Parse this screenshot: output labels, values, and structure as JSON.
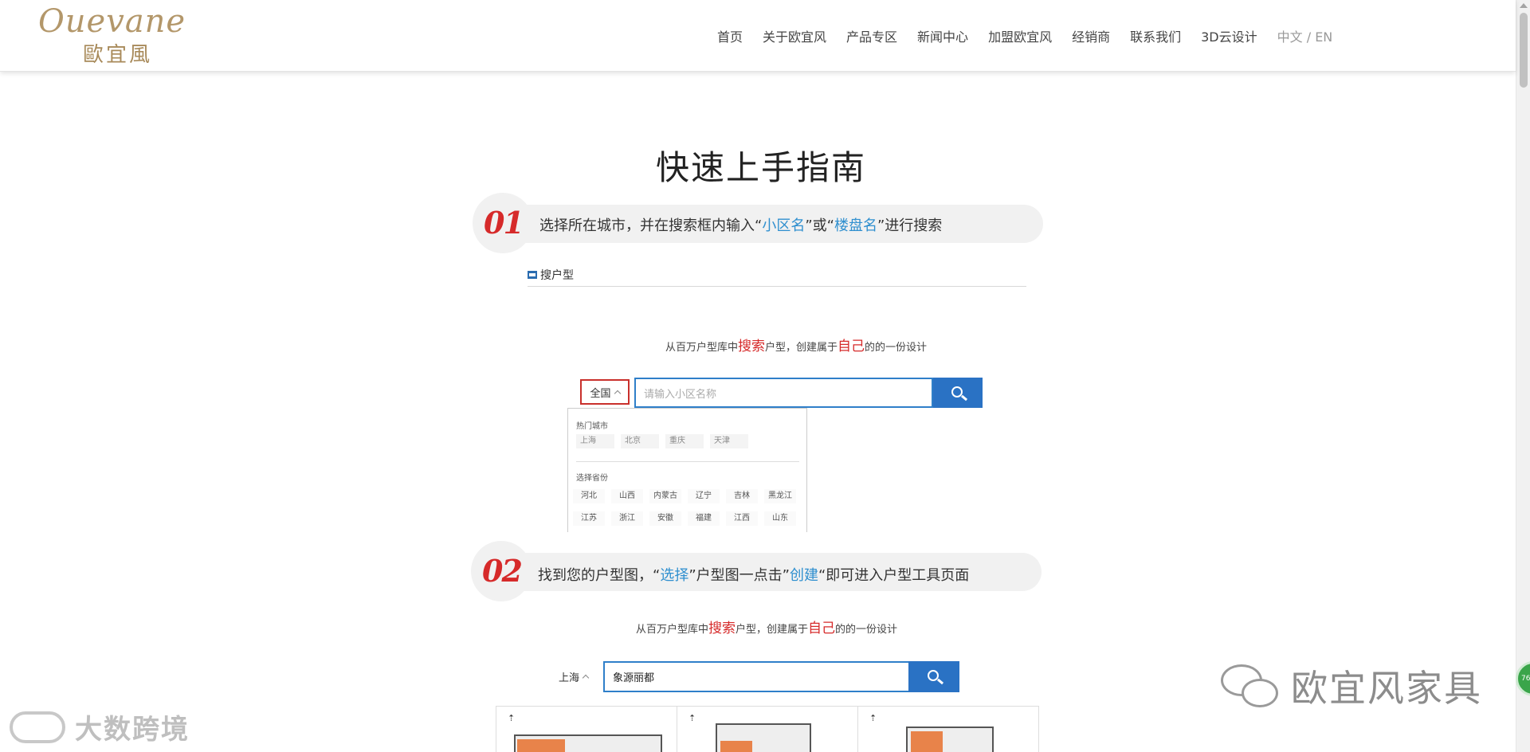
{
  "header": {
    "logo_script": "Ouevane",
    "logo_cn": "歐宜風",
    "nav": [
      "首页",
      "关于欧宜风",
      "产品专区",
      "新闻中心",
      "加盟欧宜风",
      "经销商",
      "联系我们",
      "3D云设计"
    ],
    "lang": "中文 / EN"
  },
  "main": {
    "title": "快速上手指南",
    "step1": {
      "num": "01",
      "text_a": "选择所在城市，并在搜索框内输入“",
      "hl1": "小区名",
      "text_b": "”或“",
      "hl2": "楼盘名",
      "text_c": "”进行搜索"
    },
    "section_label": "搜户型",
    "tagline": {
      "a": "从百万户型库中",
      "red1": "搜索",
      "b": "户型，创建属于",
      "red2": "自己",
      "c": "的的一份设计"
    },
    "search1": {
      "city": "全国",
      "placeholder": "请输入小区名称"
    },
    "dropdown": {
      "hot_title": "热门城市",
      "hot_cities": [
        "上海",
        "北京",
        "重庆",
        "天津"
      ],
      "prov_title": "选择省份",
      "provinces": [
        "河北",
        "山西",
        "内蒙古",
        "辽宁",
        "吉林",
        "黑龙江",
        "江苏",
        "浙江",
        "安徽",
        "福建",
        "江西",
        "山东"
      ]
    },
    "step2": {
      "num": "02",
      "text_a": "找到您的户型图，“",
      "hl1": "选择",
      "text_b": "”户型图一点击”",
      "hl2": "创建",
      "text_c": "“即可进入户型工具页面"
    },
    "search2": {
      "city": "上海",
      "value": "象源丽都"
    }
  },
  "watermarks": {
    "left": "大数跨境",
    "right": "欧宜风家具",
    "badge": "76"
  },
  "colors": {
    "accent": "#2a72c4",
    "highlight": "#2f8fcf",
    "red": "#d62a2a",
    "brand": "#b3976a"
  }
}
